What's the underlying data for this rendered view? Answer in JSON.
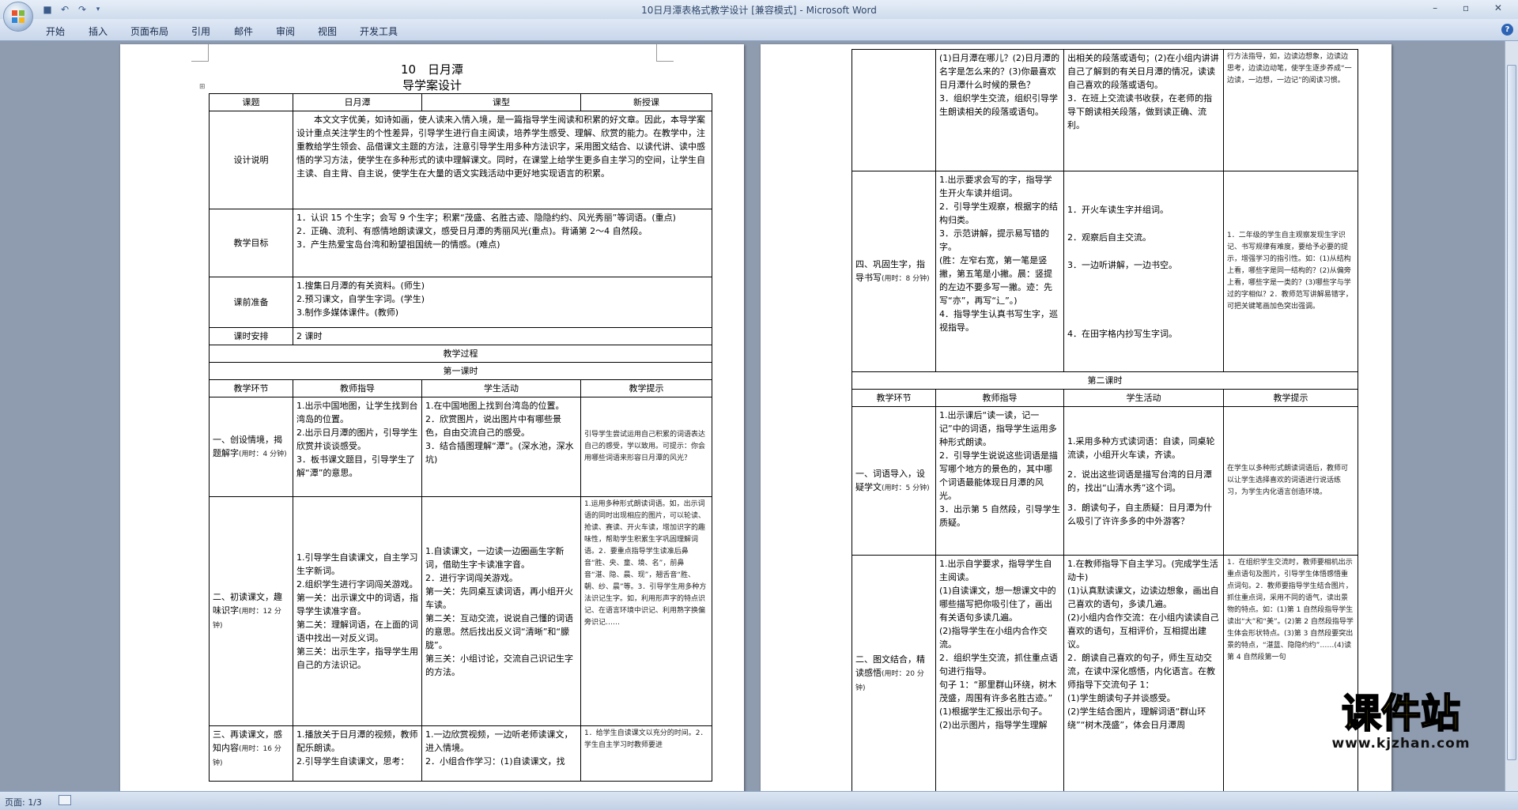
{
  "app": {
    "title": "10日月潭表格式教学设计 [兼容模式] - Microsoft Word"
  },
  "ribbon": {
    "tabs": [
      "开始",
      "插入",
      "页面布局",
      "引用",
      "邮件",
      "审阅",
      "视图",
      "开发工具"
    ]
  },
  "window_controls": "– ▫ ✕",
  "status": {
    "page": "页面: 1/3"
  },
  "watermark": {
    "text": "课件站",
    "url": "www.kjzhan.com"
  },
  "page1": {
    "title": "10　日月潭",
    "subtitle": "导学案设计",
    "info": {
      "h1": "课题",
      "v1": "日月潭",
      "h2": "课型",
      "v2": "新授课",
      "design_label": "设计说明",
      "design_text": "本文文字优美，如诗如画，使人读来入情入境，是一篇指导学生阅读和积累的好文章。因此，本导学案设计重点关注学生的个性差异，引导学生进行自主阅读，培养学生感受、理解、欣赏的能力。在教学中，注重教给学生领会、品借课文主题的方法，注意引导学生用多种方法识字，采用图文结合、以读代讲、读中感悟的学习方法，使学生在多种形式的读中理解课文。同时，在课堂上给学生更多自主学习的空间，让学生自主读、自主背、自主说，使学生在大量的语文实践活动中更好地实现语言的积累。",
      "goal_label": "教学目标",
      "goals": [
        "1．认识 15 个生字；会写 9 个生字；积累“茂盛、名胜古迹、隐隐约约、风光秀丽”等词语。(重点)",
        "2．正确、流利、有感情地朗读课文，感受日月潭的秀丽风光(重点)。背诵第 2～4 自然段。",
        "3．产生热爱宝岛台湾和盼望祖国统一的情感。(难点)"
      ],
      "prep_label": "课前准备",
      "preps": [
        "1.搜集日月潭的有关资料。(师生)",
        "2.预习课文，自学生字词。(学生)",
        "3.制作多媒体课件。(教师)"
      ],
      "hours_label": "课时安排",
      "hours_value": "2 课时",
      "process": "教学过程",
      "first": "第一课时",
      "cols": [
        "教学环节",
        "教师指导",
        "学生活动",
        "教学提示"
      ]
    },
    "rows": [
      {
        "stage": "一、创设情境，揭题解字",
        "time": "(用时：4 分钟)",
        "teacher": [
          "1.出示中国地图，让学生找到台湾岛的位置。",
          "2.出示日月潭的图片，引导学生欣赏并谈谈感受。",
          "3．板书课文题目，引导学生了解“潭”的意思。"
        ],
        "student": [
          "1.在中国地图上找到台湾岛的位置。",
          "2．欣赏图片，说出图片中有哪些景色，自由交流自己的感受。",
          "3．结合插图理解“潭”。(深水池，深水坑)"
        ],
        "tip": "引导学生尝试运用自己积累的词语表达自己的感受，学以致用。可提示：你会用哪些词语来形容日月潭的风光？"
      },
      {
        "stage": "二、初读课文，趣味识字",
        "time": "(用时：12 分钟)",
        "teacher": [
          "1.引导学生自读课文，自主学习生字新词。",
          "2.组织学生进行字词闯关游戏。",
          "第一关：出示课文中的词语，指导学生读准字音。",
          "第二关：理解词语，在上面的词语中找出一对反义词。",
          "第三关：出示生字，指导学生用自己的方法识记。"
        ],
        "student": [
          "1.自读课文，一边读一边圈画生字新词，借助生字卡读准字音。",
          "2．进行字词闯关游戏。",
          "第一关：先同桌互读词语，再小组开火车读。",
          "第二关：互动交流，说说自己懂的词语的意思。然后找出反义词“清晰”和“朦胧”。",
          "第三关：小组讨论，交流自己识记生字的方法。"
        ],
        "tip": "1.运用多种形式朗读词语。如，出示词语的同时出现相应的图片，可以轮读、抢读、赛读、开火车读，增加识字的趣味性，帮助学生积累生字巩固理解词语。2．要重点指导学生读准后鼻音“胜、央、童、境、名”，前鼻音“湛、隐、晨、现”，翘舌音“胜、朝、纱、晨”等。3．引导学生用多种方法识记生字。如，利用形声字的特点识记、在语言环境中识记、利用熟字换偏旁识记……"
      },
      {
        "stage": "三、再读课文，感知内容",
        "time": "(用时：16 分钟)",
        "teacher": [
          "1.播放关于日月潭的视频，教师配乐朗读。",
          "2.引导学生自读课文，思考："
        ],
        "student": [
          "1.一边欣赏视频，一边听老师读课文，进入情境。",
          "2．小组合作学习：(1)自读课文，找"
        ],
        "tip": "1．给学生自读课文以充分的时间。2．学生自主学习时教师要进"
      }
    ]
  },
  "page2": {
    "cont": {
      "teacher": [
        "(1)日月潭在哪儿？(2)日月潭的名字是怎么来的？(3)你最喜欢日月潭什么时候的景色？",
        "3．组织学生交流，组织引导学生朗读相关的段落或语句。"
      ],
      "student": [
        "出相关的段落或语句；(2)在小组内讲讲自己了解到的有关日月潭的情况，读读自己喜欢的段落或语句。",
        "3．在班上交流读书收获，在老师的指导下朗读相关段落，做到读正确、流利。"
      ],
      "tip": "行方法指导，如，边读边想象，边读边思考，边读边动笔，使学生逐步养成“一边读，一边想，一边记”的阅读习惯。"
    },
    "row4": {
      "stage": "四、巩固生字，指导书写",
      "time": "(用时：8 分钟)",
      "teacher": [
        "1.出示要求会写的字，指导学生开火车读并组词。",
        "2．引导学生观察，根据字的结构归类。",
        "3．示范讲解，提示易写错的字。",
        "(胜：左窄右宽，第一笔是竖撇，第五笔是小撇。晨：竖提的左边不要多写一撇。迹：先写“亦”，再写“辶”。)",
        "4．指导学生认真书写生字，巡视指导。"
      ],
      "student": [
        "1．开火车读生字并组词。",
        "2．观察后自主交流。",
        "3．一边听讲解，一边书空。",
        "4．在田字格内抄写生字词。"
      ],
      "tip": "1．二年级的学生自主观察发现生字识记、书写规律有难度，要给予必要的提示，增强学习的指引性。如：(1)从结构上看，哪些字是同一结构的？(2)从偏旁上看，哪些字是一类的？(3)哪些字与学过的字相似？2．教师范写讲解易错字，可把关键笔画加色突出强调。"
    },
    "second": "第二课时",
    "cols": [
      "教学环节",
      "教师指导",
      "学生活动",
      "教学提示"
    ],
    "rows": [
      {
        "stage": "一、词语导入，设疑学文",
        "time": "(用时：5 分钟)",
        "teacher": [
          "1.出示课后“读一读，记一记”中的词语，指导学生运用多种形式朗读。",
          "2．引导学生说说这些词语是描写哪个地方的景色的，其中哪个词语最能体现日月潭的风光。",
          "3．出示第 5 自然段，引导学生质疑。"
        ],
        "student": [
          "1.采用多种方式读词语：自读，同桌轮流读，小组开火车读，齐读。",
          "2．说出这些词语是描写台湾的日月潭的，找出“山清水秀”这个词。",
          "3．朗读句子，自主质疑：日月潭为什么吸引了许许多多的中外游客？"
        ],
        "tip": "在学生以多种形式朗读词语后，教师可以让学生选择喜欢的词语进行说话练习，为学生内化语言创造环境。"
      },
      {
        "stage": "二、图文结合，精读感悟",
        "time": "(用时：20 分钟)",
        "teacher": [
          "1.出示自学要求，指导学生自主阅读。",
          "(1)自读课文，想一想课文中的哪些描写把你吸引住了，画出有关语句多读几遍。",
          "(2)指导学生在小组内合作交流。",
          "2．组织学生交流，抓住重点语句进行指导。",
          "句子 1：“那里群山环绕，树木茂盛，周围有许多名胜古迹。”",
          "(1)根据学生汇报出示句子。",
          "(2)出示图片，指导学生理解"
        ],
        "student": [
          "1.在教师指导下自主学习。(完成学生活动卡)",
          "(1)认真默读课文，边读边想象，画出自己喜欢的语句，多读几遍。",
          "(2)小组内合作交流：在小组内读读自己喜欢的语句，互相评价，互相提出建议。",
          "2．朗读自己喜欢的句子，师生互动交流，在读中深化感悟，内化语言。在教师指导下交流句子 1：",
          "(1)学生朗读句子并谈感受。",
          "(2)学生结合图片，理解词语“群山环绕”“树木茂盛”，体会日月潭周"
        ],
        "tip": "1．在组织学生交流时，教师要相机出示重点语句及图片，引导学生体悟感悟重点词句。2．教师要指导学生结合图片，抓住重点词，采用不同的语气，读出景物的特点。如：(1)第 1 自然段指导学生读出“大”和“美”。(2)第 2 自然段指导学生体会形状特点。(3)第 3 自然段要突出景的特点，“湛蓝、隐隐约约”……(4)读第 4 自然段第一句"
      }
    ]
  }
}
